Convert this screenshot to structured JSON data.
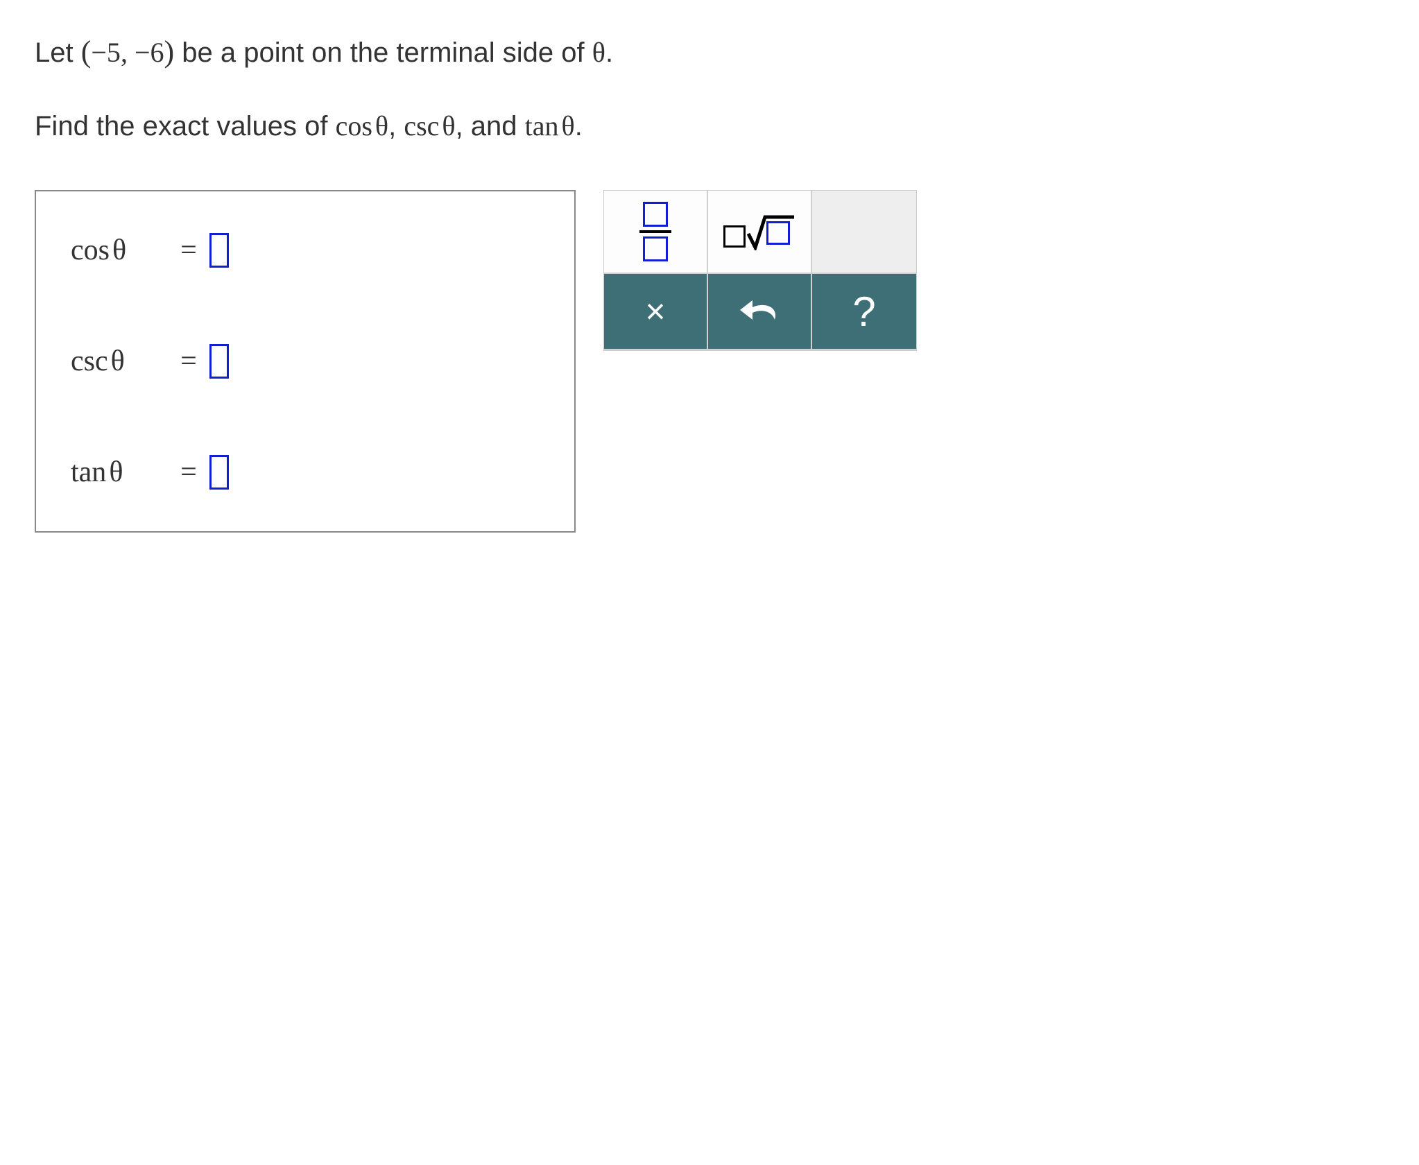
{
  "question": {
    "line1_pre": "Let ",
    "point_open": "(",
    "point_x": "−5",
    "point_sep": ", ",
    "point_y": "−6",
    "point_close": ")",
    "line1_post": " be a point on the terminal side of ",
    "theta1": "θ",
    "line1_end": ".",
    "line2_pre": "Find the exact values of ",
    "fn1": "cos",
    "fn2": "csc",
    "fn3": "tan",
    "theta": "θ",
    "sep": ", ",
    "and": "and ",
    "line2_end": "."
  },
  "answers": {
    "rows": [
      {
        "label_fn": "cos",
        "label_arg": "θ",
        "eq": "="
      },
      {
        "label_fn": "csc",
        "label_arg": "θ",
        "eq": "="
      },
      {
        "label_fn": "tan",
        "label_arg": "θ",
        "eq": "="
      }
    ]
  },
  "keypad": {
    "fraction_name": "fraction-template",
    "root_name": "coefficient-root-template",
    "clear_symbol": "×",
    "undo_name": "undo",
    "help_symbol": "?"
  }
}
